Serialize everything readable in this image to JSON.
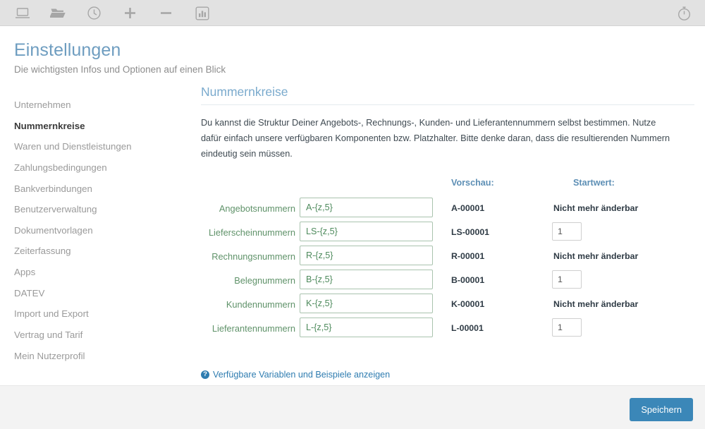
{
  "toolbar": {
    "left_icons": [
      {
        "name": "laptop-icon",
        "label": "Laptop"
      },
      {
        "name": "folder-open-icon",
        "label": "Ordner öffnen"
      },
      {
        "name": "clock-icon",
        "label": "Uhr"
      },
      {
        "name": "plus-icon",
        "label": "Plus"
      },
      {
        "name": "minus-icon",
        "label": "Minus"
      },
      {
        "name": "bar-chart-icon",
        "label": "Statistik"
      }
    ],
    "right_icons": [
      {
        "name": "stopwatch-icon",
        "label": "Stoppuhr"
      }
    ],
    "background_color": "#e2e2e2"
  },
  "header": {
    "title": "Einstellungen",
    "subtitle": "Die wichtigsten Infos und Optionen auf einen Blick",
    "title_color": "#6e9dc0"
  },
  "sidebar": {
    "items": [
      {
        "label": "Unternehmen",
        "active": false
      },
      {
        "label": "Nummernkreise",
        "active": true
      },
      {
        "label": "Waren und Dienstleistungen",
        "active": false
      },
      {
        "label": "Zahlungsbedingungen",
        "active": false
      },
      {
        "label": "Bankverbindungen",
        "active": false
      },
      {
        "label": "Benutzerverwaltung",
        "active": false
      },
      {
        "label": "Dokumentvorlagen",
        "active": false
      },
      {
        "label": "Zeiterfassung",
        "active": false
      },
      {
        "label": "Apps",
        "active": false
      },
      {
        "label": "DATEV",
        "active": false
      },
      {
        "label": "Import und Export",
        "active": false
      },
      {
        "label": "Vertrag und Tarif",
        "active": false
      },
      {
        "label": "Mein Nutzerprofil",
        "active": false
      }
    ]
  },
  "content": {
    "section_title": "Nummernkreise",
    "description": "Du kannst die Struktur Deiner Angebots-, Rechnungs-, Kunden- und Lieferantennummern selbst bestimmen. Nutze dafür einfach unsere verfügbaren Komponenten bzw. Platzhalter. Bitte denke daran, dass die resultierenden Nummern eindeutig sein müssen.",
    "columns": {
      "preview": "Vorschau:",
      "startvalue": "Startwert:"
    },
    "rows": [
      {
        "label": "Angebotsnummern",
        "pattern": "A-{z,5}",
        "preview": "A-00001",
        "start_kind": "text",
        "start_text": "Nicht mehr änderbar"
      },
      {
        "label": "Lieferscheinnummern",
        "pattern": "LS-{z,5}",
        "preview": "LS-00001",
        "start_kind": "input",
        "start_value": "1"
      },
      {
        "label": "Rechnungsnummern",
        "pattern": "R-{z,5}",
        "preview": "R-00001",
        "start_kind": "text",
        "start_text": "Nicht mehr änderbar"
      },
      {
        "label": "Belegnummern",
        "pattern": "B-{z,5}",
        "preview": "B-00001",
        "start_kind": "input",
        "start_value": "1"
      },
      {
        "label": "Kundennummern",
        "pattern": "K-{z,5}",
        "preview": "K-00001",
        "start_kind": "text",
        "start_text": "Nicht mehr änderbar"
      },
      {
        "label": "Lieferantennummern",
        "pattern": "L-{z,5}",
        "preview": "L-00001",
        "start_kind": "input",
        "start_value": "1"
      }
    ],
    "help_link": {
      "icon": "question-circle-icon",
      "glyph": "?",
      "label": "Verfügbare Variablen und Beispiele anzeigen"
    }
  },
  "footer": {
    "save_label": "Speichern",
    "save_color": "#3b87b8"
  }
}
